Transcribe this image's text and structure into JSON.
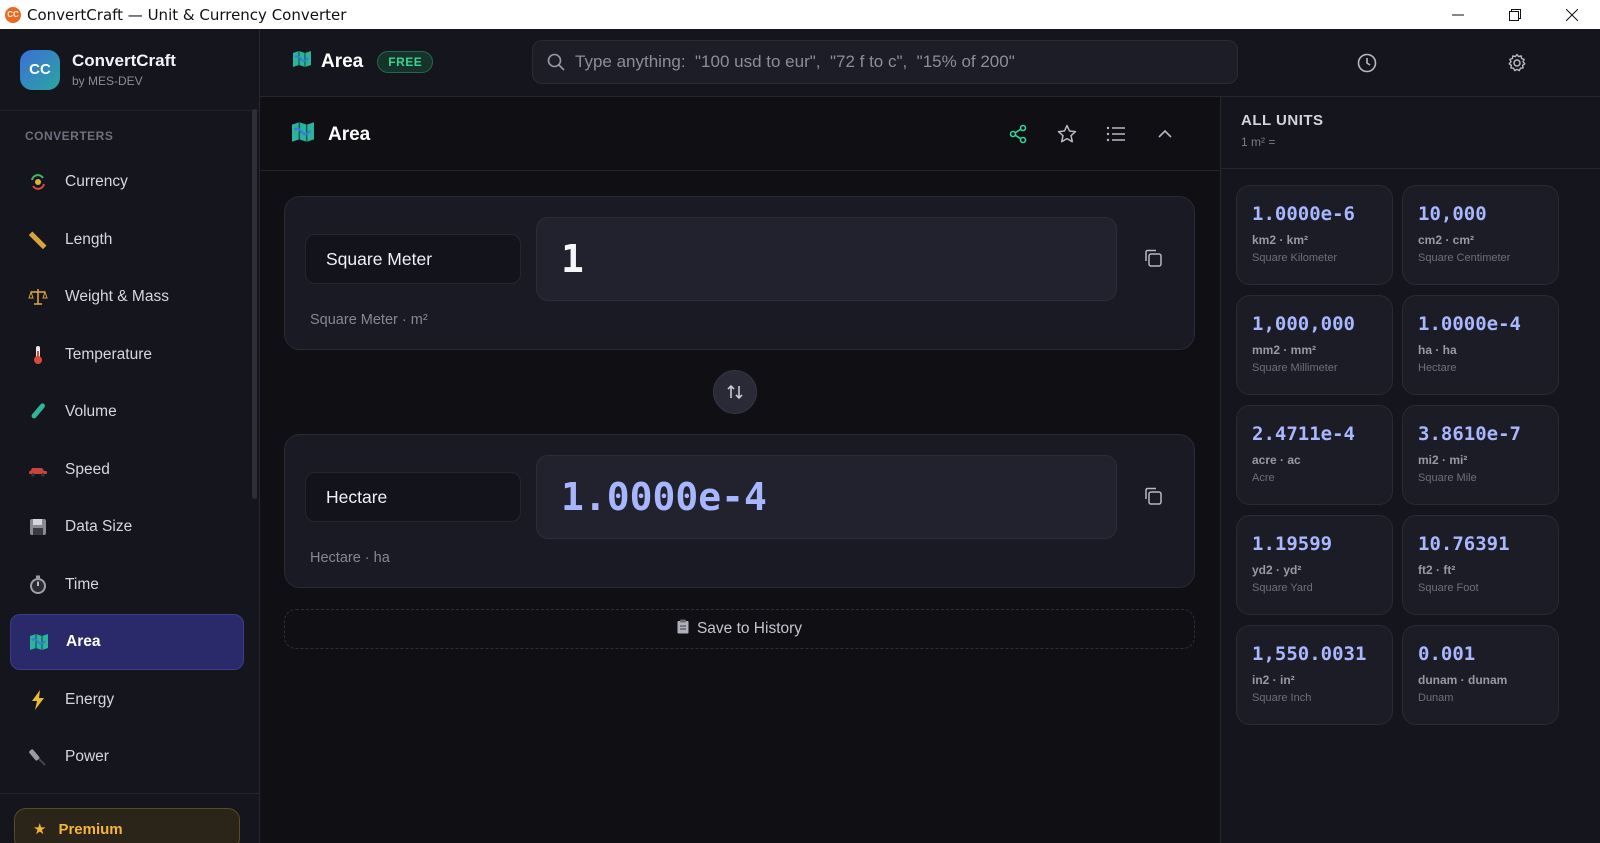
{
  "window": {
    "title": "ConvertCraft — Unit & Currency Converter",
    "icon_text": "CC"
  },
  "brand": {
    "logo": "CC",
    "name": "ConvertCraft",
    "byline": "by MES-DEV"
  },
  "sidebar": {
    "section_label": "CONVERTERS",
    "items": [
      {
        "label": "Currency",
        "icon": "currency-exchange-icon",
        "active": false
      },
      {
        "label": "Length",
        "icon": "ruler-icon",
        "active": false
      },
      {
        "label": "Weight & Mass",
        "icon": "scale-icon",
        "active": false
      },
      {
        "label": "Temperature",
        "icon": "thermometer-icon",
        "active": false
      },
      {
        "label": "Volume",
        "icon": "test-tube-icon",
        "active": false
      },
      {
        "label": "Speed",
        "icon": "car-icon",
        "active": false
      },
      {
        "label": "Data Size",
        "icon": "floppy-disk-icon",
        "active": false
      },
      {
        "label": "Time",
        "icon": "stopwatch-icon",
        "active": false
      },
      {
        "label": "Area",
        "icon": "map-icon",
        "active": true
      },
      {
        "label": "Energy",
        "icon": "lightning-icon",
        "active": false
      },
      {
        "label": "Power",
        "icon": "plug-icon",
        "active": false
      }
    ],
    "premium_label": "Premium"
  },
  "header": {
    "title": "Area",
    "badge": "FREE",
    "search_placeholder": "Type anything:  \"100 usd to eur\",  \"72 f to c\",  \"15% of 200\""
  },
  "panel": {
    "title": "Area",
    "from": {
      "unit": "Square Meter",
      "value": "1",
      "caption": "Square Meter · m²"
    },
    "to": {
      "unit": "Hectare",
      "value": "1.0000e-4",
      "caption": "Hectare · ha"
    },
    "save_label": "Save to History"
  },
  "all_units": {
    "title": "ALL UNITS",
    "subtitle": "1 m² =",
    "items": [
      {
        "value": "1.0000e-6",
        "code": "km2 · km²",
        "name": "Square Kilometer"
      },
      {
        "value": "10,000",
        "code": "cm2 · cm²",
        "name": "Square Centimeter"
      },
      {
        "value": "1,000,000",
        "code": "mm2 · mm²",
        "name": "Square Millimeter"
      },
      {
        "value": "1.0000e-4",
        "code": "ha · ha",
        "name": "Hectare"
      },
      {
        "value": "2.4711e-4",
        "code": "acre · ac",
        "name": "Acre"
      },
      {
        "value": "3.8610e-7",
        "code": "mi2 · mi²",
        "name": "Square Mile"
      },
      {
        "value": "1.19599",
        "code": "yd2 · yd²",
        "name": "Square Yard"
      },
      {
        "value": "10.76391",
        "code": "ft2 · ft²",
        "name": "Square Foot"
      },
      {
        "value": "1,550.0031",
        "code": "in2 · in²",
        "name": "Square Inch"
      },
      {
        "value": "0.001",
        "code": "dunam · dunam",
        "name": "Dunam"
      }
    ]
  },
  "colors": {
    "accent": "#a7b6ff",
    "active_nav": "#2a2a6a",
    "free_badge": "#3ad193",
    "premium": "#f3b53b",
    "share_icon": "#3ad193"
  }
}
